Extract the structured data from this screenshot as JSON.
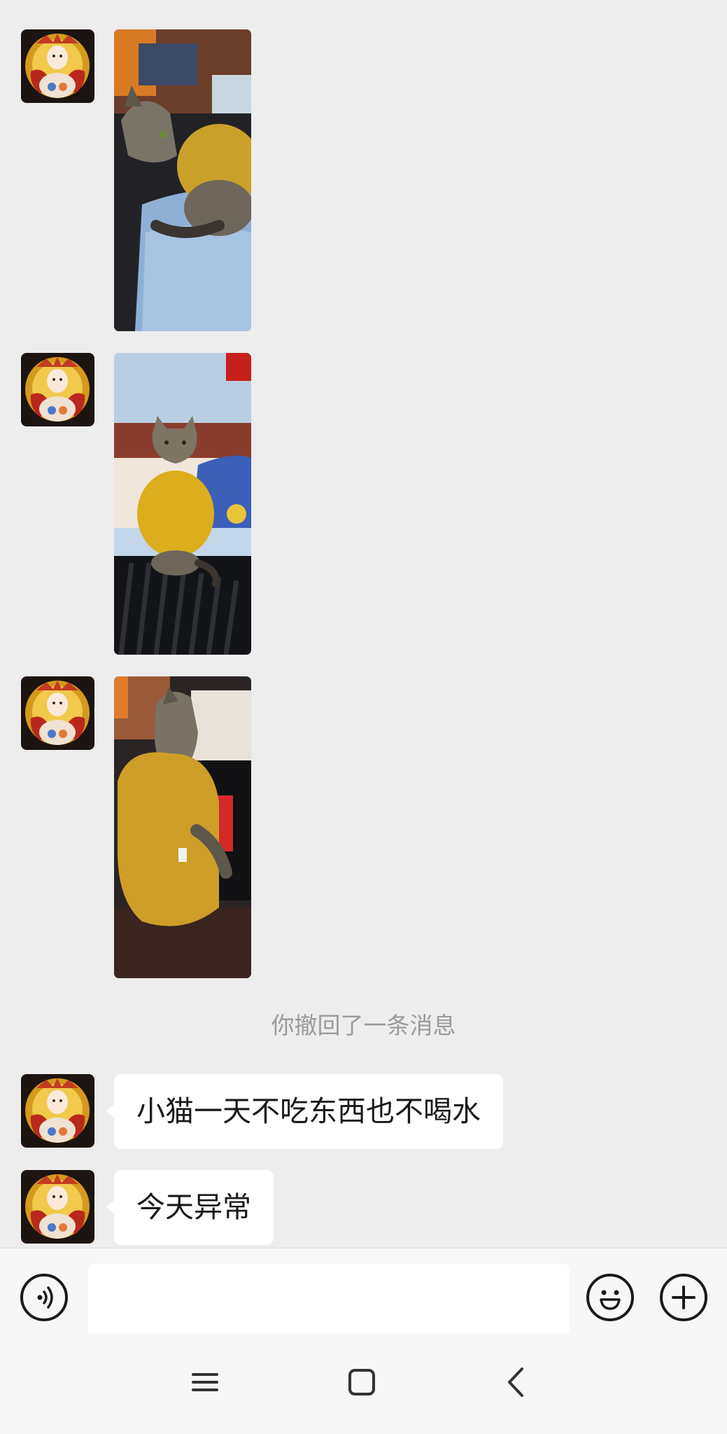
{
  "chat": {
    "photo_messages": [
      {
        "image": "cat-in-yellow-sweater-on-bed-side-view"
      },
      {
        "image": "cat-in-yellow-sweater-sitting-facing-camera"
      },
      {
        "image": "cat-in-yellow-sweater-on-chair-back-view"
      }
    ],
    "system_notice": "你撤回了一条消息",
    "text_messages": [
      {
        "text": "小猫一天不吃东西也不喝水"
      },
      {
        "text": "今天异常"
      }
    ],
    "avatar": "golden-buddhist-deity-illustration"
  },
  "input_bar": {
    "voice_icon": "voice-icon",
    "input_value": "",
    "emoji_icon": "emoji-icon",
    "more_icon": "plus-icon"
  },
  "nav_bar": {
    "icons": [
      "menu-icon",
      "home-icon",
      "back-icon"
    ]
  },
  "colors": {
    "chat_background": "#ededed",
    "bubble": "#ffffff",
    "system_text": "#9a9a9a",
    "bar_background": "#f7f7f7"
  }
}
